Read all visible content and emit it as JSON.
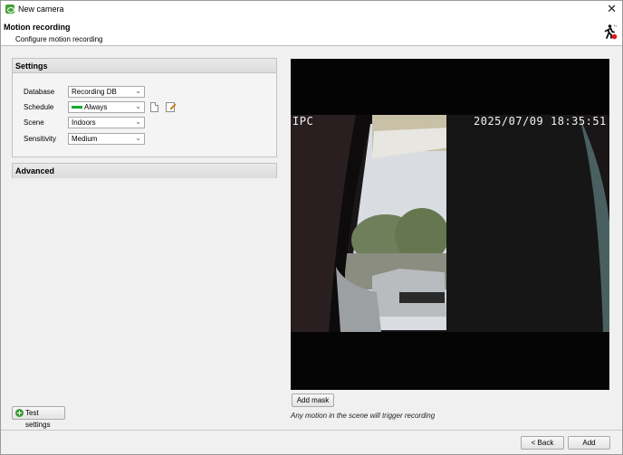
{
  "window": {
    "title": "New camera",
    "close_glyph": "✕"
  },
  "header": {
    "title": "Motion recording",
    "subtitle": "Configure motion recording",
    "icon": "motion-person-icon"
  },
  "settings": {
    "section_label": "Settings",
    "database": {
      "label": "Database",
      "value": "Recording DB"
    },
    "schedule": {
      "label": "Schedule",
      "value": "Always",
      "swatch_color": "#1aa82e"
    },
    "scene": {
      "label": "Scene",
      "value": "Indoors"
    },
    "sensitivity": {
      "label": "Sensitivity",
      "value": "Medium"
    }
  },
  "advanced": {
    "section_label": "Advanced"
  },
  "camera": {
    "overlay_left": "IPC",
    "overlay_timestamp": "2025/07/09  18:35:51"
  },
  "buttons": {
    "add_mask": "Add mask",
    "test_settings": "Test settings",
    "back": "< Back",
    "add": "Add"
  },
  "note": "Any motion in the scene will trigger recording"
}
